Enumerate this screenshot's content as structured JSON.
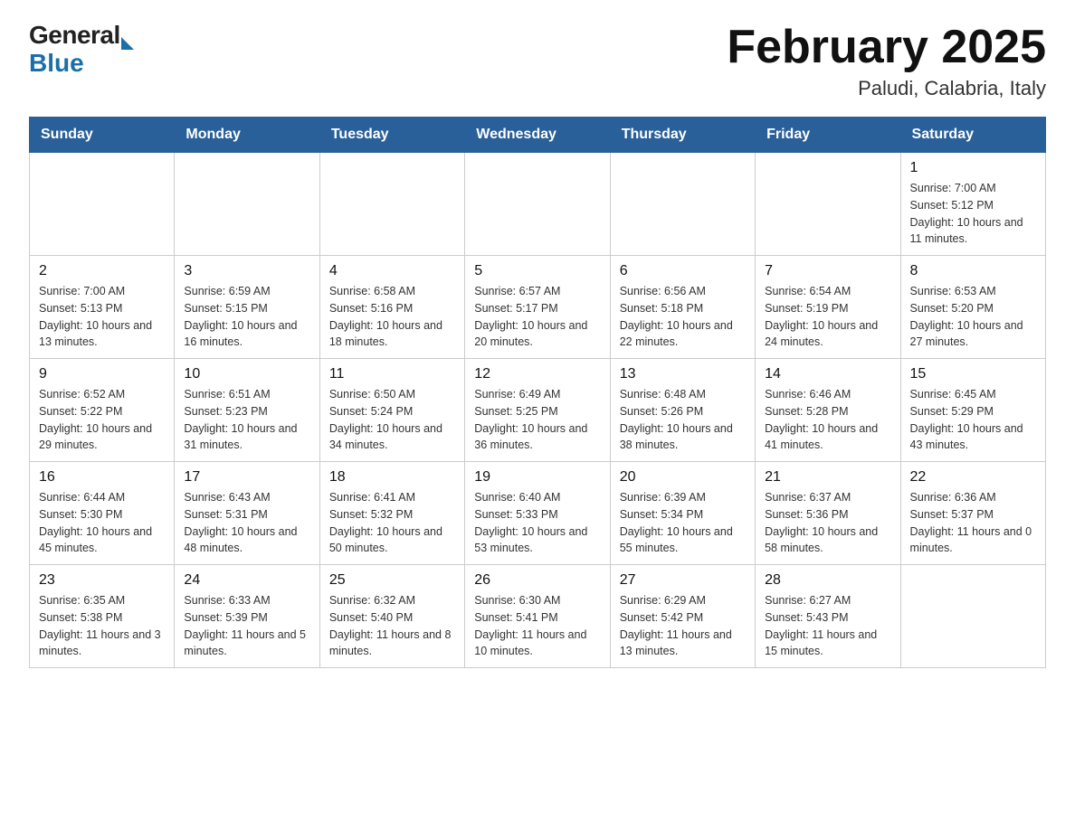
{
  "header": {
    "logo_general": "General",
    "logo_blue": "Blue",
    "month_title": "February 2025",
    "location": "Paludi, Calabria, Italy"
  },
  "weekdays": [
    "Sunday",
    "Monday",
    "Tuesday",
    "Wednesday",
    "Thursday",
    "Friday",
    "Saturday"
  ],
  "weeks": [
    [
      {
        "day": "",
        "info": ""
      },
      {
        "day": "",
        "info": ""
      },
      {
        "day": "",
        "info": ""
      },
      {
        "day": "",
        "info": ""
      },
      {
        "day": "",
        "info": ""
      },
      {
        "day": "",
        "info": ""
      },
      {
        "day": "1",
        "info": "Sunrise: 7:00 AM\nSunset: 5:12 PM\nDaylight: 10 hours\nand 11 minutes."
      }
    ],
    [
      {
        "day": "2",
        "info": "Sunrise: 7:00 AM\nSunset: 5:13 PM\nDaylight: 10 hours\nand 13 minutes."
      },
      {
        "day": "3",
        "info": "Sunrise: 6:59 AM\nSunset: 5:15 PM\nDaylight: 10 hours\nand 16 minutes."
      },
      {
        "day": "4",
        "info": "Sunrise: 6:58 AM\nSunset: 5:16 PM\nDaylight: 10 hours\nand 18 minutes."
      },
      {
        "day": "5",
        "info": "Sunrise: 6:57 AM\nSunset: 5:17 PM\nDaylight: 10 hours\nand 20 minutes."
      },
      {
        "day": "6",
        "info": "Sunrise: 6:56 AM\nSunset: 5:18 PM\nDaylight: 10 hours\nand 22 minutes."
      },
      {
        "day": "7",
        "info": "Sunrise: 6:54 AM\nSunset: 5:19 PM\nDaylight: 10 hours\nand 24 minutes."
      },
      {
        "day": "8",
        "info": "Sunrise: 6:53 AM\nSunset: 5:20 PM\nDaylight: 10 hours\nand 27 minutes."
      }
    ],
    [
      {
        "day": "9",
        "info": "Sunrise: 6:52 AM\nSunset: 5:22 PM\nDaylight: 10 hours\nand 29 minutes."
      },
      {
        "day": "10",
        "info": "Sunrise: 6:51 AM\nSunset: 5:23 PM\nDaylight: 10 hours\nand 31 minutes."
      },
      {
        "day": "11",
        "info": "Sunrise: 6:50 AM\nSunset: 5:24 PM\nDaylight: 10 hours\nand 34 minutes."
      },
      {
        "day": "12",
        "info": "Sunrise: 6:49 AM\nSunset: 5:25 PM\nDaylight: 10 hours\nand 36 minutes."
      },
      {
        "day": "13",
        "info": "Sunrise: 6:48 AM\nSunset: 5:26 PM\nDaylight: 10 hours\nand 38 minutes."
      },
      {
        "day": "14",
        "info": "Sunrise: 6:46 AM\nSunset: 5:28 PM\nDaylight: 10 hours\nand 41 minutes."
      },
      {
        "day": "15",
        "info": "Sunrise: 6:45 AM\nSunset: 5:29 PM\nDaylight: 10 hours\nand 43 minutes."
      }
    ],
    [
      {
        "day": "16",
        "info": "Sunrise: 6:44 AM\nSunset: 5:30 PM\nDaylight: 10 hours\nand 45 minutes."
      },
      {
        "day": "17",
        "info": "Sunrise: 6:43 AM\nSunset: 5:31 PM\nDaylight: 10 hours\nand 48 minutes."
      },
      {
        "day": "18",
        "info": "Sunrise: 6:41 AM\nSunset: 5:32 PM\nDaylight: 10 hours\nand 50 minutes."
      },
      {
        "day": "19",
        "info": "Sunrise: 6:40 AM\nSunset: 5:33 PM\nDaylight: 10 hours\nand 53 minutes."
      },
      {
        "day": "20",
        "info": "Sunrise: 6:39 AM\nSunset: 5:34 PM\nDaylight: 10 hours\nand 55 minutes."
      },
      {
        "day": "21",
        "info": "Sunrise: 6:37 AM\nSunset: 5:36 PM\nDaylight: 10 hours\nand 58 minutes."
      },
      {
        "day": "22",
        "info": "Sunrise: 6:36 AM\nSunset: 5:37 PM\nDaylight: 11 hours\nand 0 minutes."
      }
    ],
    [
      {
        "day": "23",
        "info": "Sunrise: 6:35 AM\nSunset: 5:38 PM\nDaylight: 11 hours\nand 3 minutes."
      },
      {
        "day": "24",
        "info": "Sunrise: 6:33 AM\nSunset: 5:39 PM\nDaylight: 11 hours\nand 5 minutes."
      },
      {
        "day": "25",
        "info": "Sunrise: 6:32 AM\nSunset: 5:40 PM\nDaylight: 11 hours\nand 8 minutes."
      },
      {
        "day": "26",
        "info": "Sunrise: 6:30 AM\nSunset: 5:41 PM\nDaylight: 11 hours\nand 10 minutes."
      },
      {
        "day": "27",
        "info": "Sunrise: 6:29 AM\nSunset: 5:42 PM\nDaylight: 11 hours\nand 13 minutes."
      },
      {
        "day": "28",
        "info": "Sunrise: 6:27 AM\nSunset: 5:43 PM\nDaylight: 11 hours\nand 15 minutes."
      },
      {
        "day": "",
        "info": ""
      }
    ]
  ]
}
